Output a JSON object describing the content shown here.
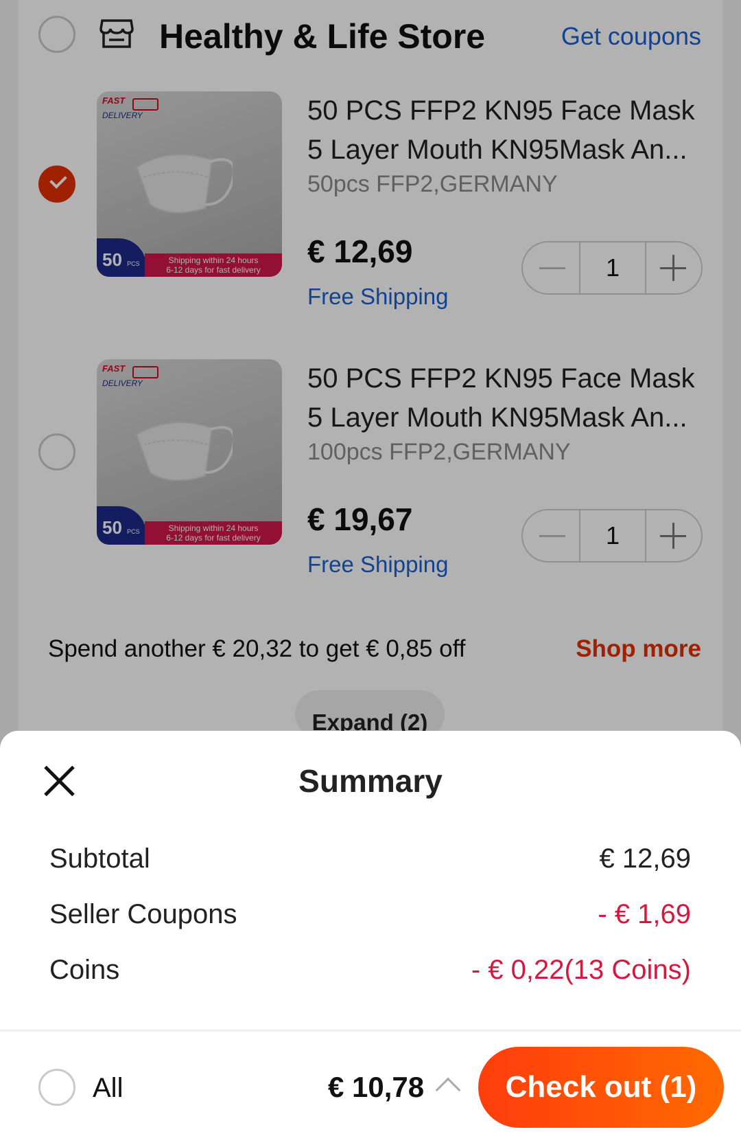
{
  "store": {
    "name": "Healthy & Life Store",
    "coupons_link": "Get coupons",
    "selected": false
  },
  "products": [
    {
      "title": "50 PCS FFP2 KN95 Face Mask 5 Layer Mouth KN95Mask An...",
      "variant": "50pcs FFP2,GERMANY",
      "price": "€ 12,69",
      "shipping": "Free Shipping",
      "quantity": "1",
      "selected": true,
      "image": {
        "badge_fast": "FAST",
        "badge_delivery": "DELIVERY",
        "pcs_count": "50",
        "pcs_unit": "PCS",
        "ship_line1": "Shipping within 24 hours",
        "ship_line2": "6-12 days for fast delivery"
      }
    },
    {
      "title": "50 PCS FFP2 KN95 Face Mask 5 Layer Mouth KN95Mask An...",
      "variant": "100pcs FFP2,GERMANY",
      "price": "€ 19,67",
      "shipping": "Free Shipping",
      "quantity": "1",
      "selected": false,
      "image": {
        "badge_fast": "FAST",
        "badge_delivery": "DELIVERY",
        "pcs_count": "50",
        "pcs_unit": "PCS",
        "ship_line1": "Shipping within 24 hours",
        "ship_line2": "6-12 days for fast delivery"
      }
    }
  ],
  "promo": {
    "text": "Spend another € 20,32 to get € 0,85 off",
    "link": "Shop more"
  },
  "expand_label": "Expand (2)",
  "summary": {
    "title": "Summary",
    "rows": [
      {
        "label": "Subtotal",
        "value": "€ 12,69"
      },
      {
        "label": "Seller Coupons",
        "value": "- € 1,69"
      },
      {
        "label": "Coins",
        "value": "- € 0,22(13 Coins)"
      }
    ]
  },
  "footer": {
    "all_label": "All",
    "total": "€ 10,78",
    "checkout_label": "Check out (1)"
  },
  "colors": {
    "accent": "#e62e04",
    "link": "#1a5fd1",
    "discount": "#d8173f",
    "checkout_start": "#ff3d0d",
    "checkout_end": "#ff6a00"
  }
}
